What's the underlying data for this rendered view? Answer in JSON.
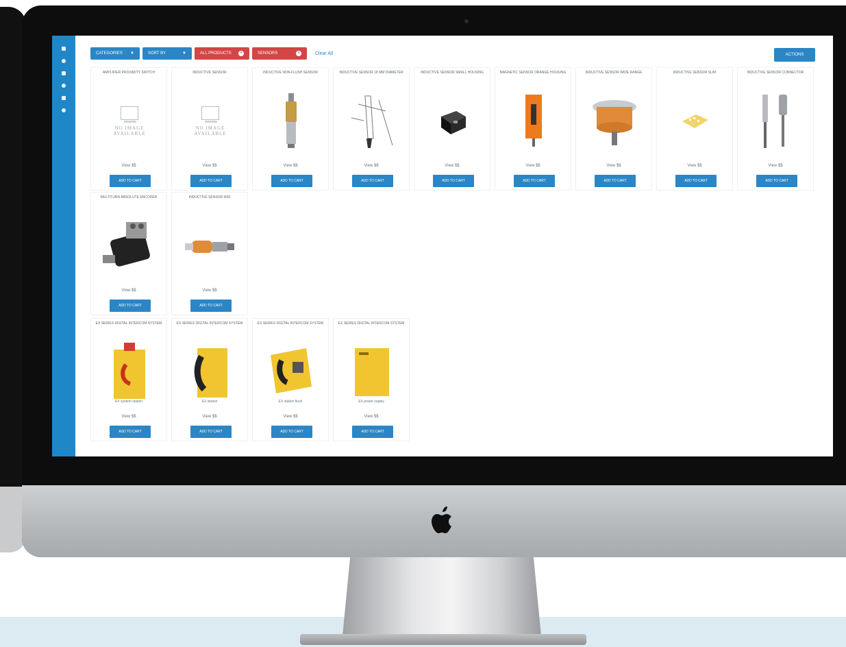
{
  "colors": {
    "accent": "#2b86c6",
    "alert": "#d24646",
    "rail": "#1f86c8"
  },
  "icons": [
    "apple-logo-icon",
    "no-image-icon",
    "close-icon",
    "chevron-down-icon"
  ],
  "toolbar": {
    "filters": [
      {
        "type": "dropdown",
        "label": "CATEGORIES"
      },
      {
        "type": "dropdown",
        "label": "SORT BY"
      },
      {
        "type": "removable",
        "label": "ALL PRODUCTS"
      },
      {
        "type": "removable",
        "label": "SENSORS"
      }
    ],
    "clear_label": "Clear All",
    "right_button": "ACTIONS"
  },
  "products": [
    {
      "title": "AMPLIFIER PROXIMITY SWITCH",
      "image": "no-image",
      "price": "View $$",
      "cta": "ADD TO CART"
    },
    {
      "title": "INDUCTIVE SENSOR",
      "image": "no-image",
      "price": "View $$",
      "cta": "ADD TO CART"
    },
    {
      "title": "INDUCTIVE NON-FLUSH SENSOR",
      "image": "inductive-sensor",
      "price": "View $$",
      "cta": "ADD TO CART"
    },
    {
      "title": "INDUCTIVE SENSOR 18 MM DIAMETER",
      "image": "drawing",
      "price": "View $$",
      "cta": "ADD TO CART"
    },
    {
      "title": "INDUCTIVE SENSOR SMALL HOUSING",
      "image": "block",
      "price": "View $$",
      "cta": "ADD TO CART"
    },
    {
      "title": "MAGNETIC SENSOR ORANGE HOUSING",
      "image": "orange-sensor",
      "price": "View $$",
      "cta": "ADD TO CART"
    },
    {
      "title": "INDUCTIVE SENSOR WIDE RANGE",
      "image": "ring-sensor",
      "price": "View $$",
      "cta": "ADD TO CART"
    },
    {
      "title": "INDUCTIVE SENSOR SLIM",
      "image": "small-part",
      "price": "View $$",
      "cta": "ADD TO CART"
    },
    {
      "title": "INDUCTIVE SENSOR CONNECTOR",
      "image": "cable-sensor",
      "price": "View $$",
      "cta": "ADD TO CART"
    },
    {
      "title": "MULTITURN ABSOLUTE ENCODER",
      "image": "encoder",
      "price": "View $$",
      "cta": "ADD TO CART"
    },
    {
      "title": "INDUCTIVE SENSOR M30",
      "image": "m-sensor",
      "price": "View $$",
      "cta": "ADD TO CART"
    },
    {
      "title": "EX SERIES DIGITAL INTERCOM SYSTEM",
      "image": "yellow-phone-1",
      "caption": "EX system station",
      "price": "View $$",
      "cta": "ADD TO CART"
    },
    {
      "title": "EX SERIES DIGITAL INTERCOM SYSTEM",
      "image": "yellow-phone-2",
      "caption": "EX station",
      "price": "View $$",
      "cta": "ADD TO CART"
    },
    {
      "title": "EX SERIES DIGITAL INTERCOM SYSTEM",
      "image": "yellow-phone-3",
      "caption": "EX station flush",
      "price": "View $$",
      "cta": "ADD TO CART"
    },
    {
      "title": "EX SERIES DIGITAL INTERCOM SYSTEM",
      "image": "yellow-box",
      "caption": "EX power supply",
      "price": "View $$",
      "cta": "ADD TO CART"
    }
  ]
}
